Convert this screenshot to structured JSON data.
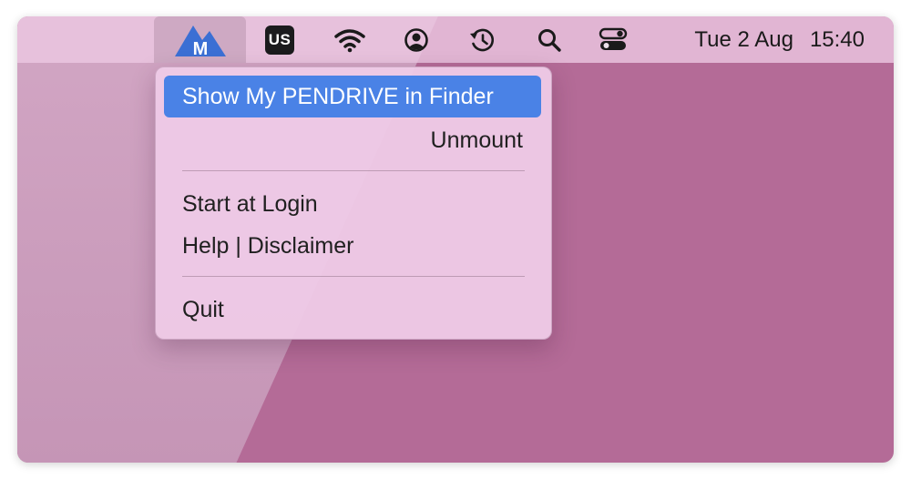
{
  "menubar": {
    "app_icon": "mountain-m-icon",
    "input_source": "US",
    "status_icons": [
      "wifi-icon",
      "user-account-icon",
      "time-machine-icon",
      "search-icon",
      "control-center-icon"
    ],
    "date": "Tue 2 Aug",
    "time": "15:40"
  },
  "menu": {
    "items": [
      {
        "label": "Show My PENDRIVE in Finder",
        "selected": true
      },
      {
        "label": "Unmount"
      },
      {
        "label": "Start at Login"
      },
      {
        "label": "Help | Disclaimer"
      },
      {
        "label": "Quit"
      }
    ]
  },
  "colors": {
    "selection": "#4a82e6",
    "app_icon": "#3b6fd4",
    "desktop": "#b46b97"
  }
}
